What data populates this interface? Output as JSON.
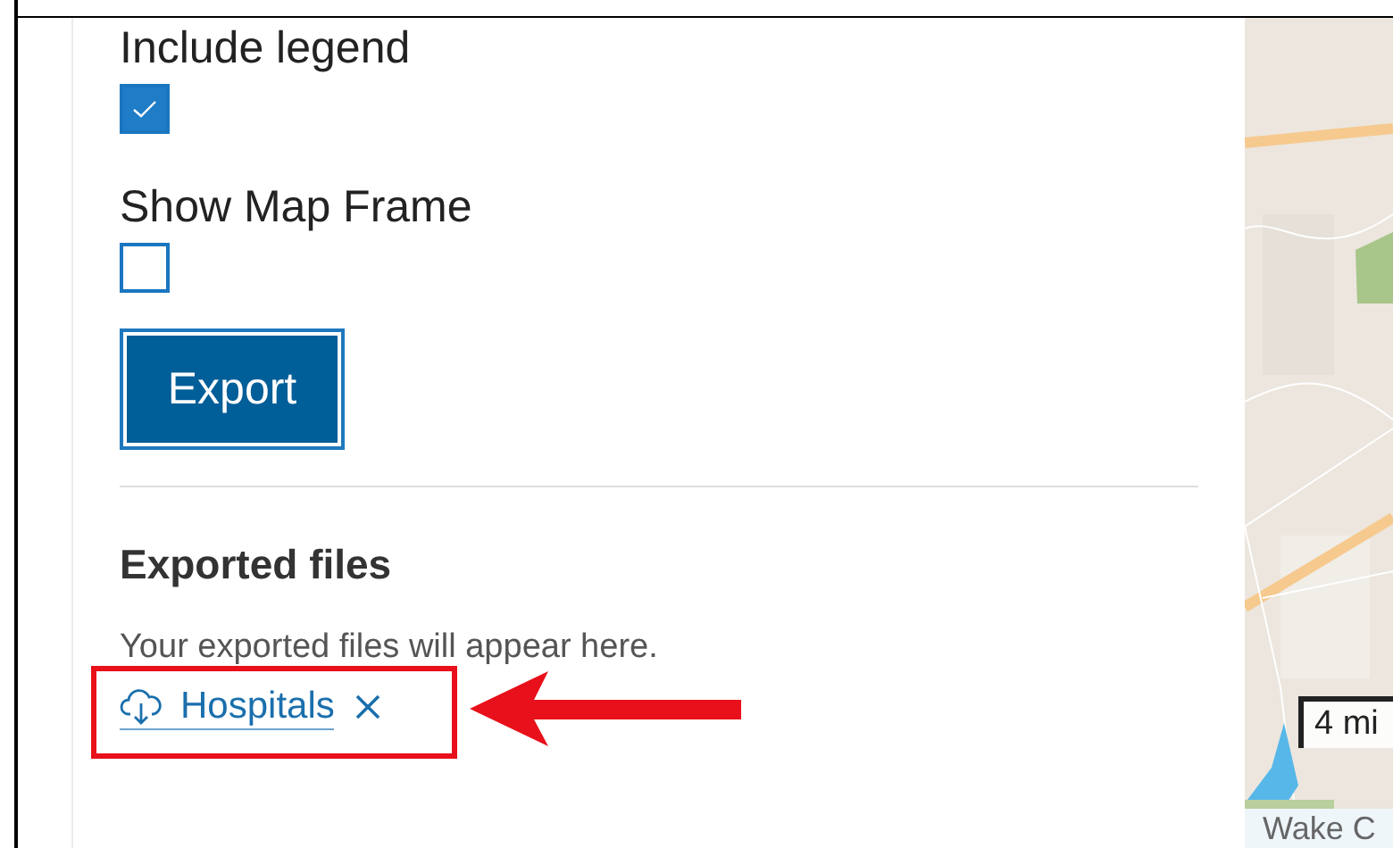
{
  "options": [
    {
      "label": "Include legend",
      "checked": true
    },
    {
      "label": "Show Map Frame",
      "checked": false
    }
  ],
  "export_button": "Export",
  "exported_files": {
    "title": "Exported files",
    "hint": "Your exported files will appear here.",
    "files": [
      {
        "name": "Hospitals"
      }
    ]
  },
  "map": {
    "scale": "4 mi",
    "attribution": "Wake C"
  }
}
